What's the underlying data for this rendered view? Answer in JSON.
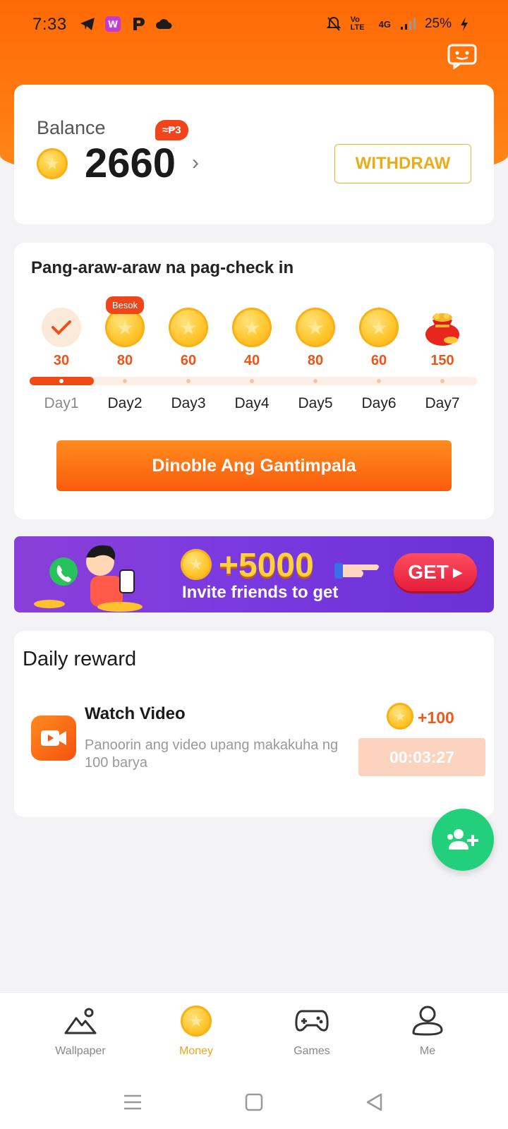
{
  "status_bar": {
    "time": "7:33",
    "network": "Vo LTE",
    "signal": "4G",
    "battery": "25%"
  },
  "balance": {
    "label": "Balance",
    "value": "2660",
    "peso_badge": "≈₱3",
    "withdraw_label": "WITHDRAW"
  },
  "checkin": {
    "title": "Pang-araw-araw na pag-check in",
    "tomorrow_badge": "Besok",
    "days": [
      {
        "amount": "30",
        "label": "Day1",
        "state": "checked"
      },
      {
        "amount": "80",
        "label": "Day2",
        "state": "coin"
      },
      {
        "amount": "60",
        "label": "Day3",
        "state": "coin"
      },
      {
        "amount": "40",
        "label": "Day4",
        "state": "coin"
      },
      {
        "amount": "80",
        "label": "Day5",
        "state": "coin"
      },
      {
        "amount": "60",
        "label": "Day6",
        "state": "coin"
      },
      {
        "amount": "150",
        "label": "Day7",
        "state": "bag"
      }
    ],
    "progress_fraction": 0.143,
    "double_button_label": "Dinoble Ang Gantimpala"
  },
  "banner": {
    "amount": "+5000",
    "text": "Invite friends to get",
    "get_label": "GET"
  },
  "daily_reward": {
    "title": "Daily reward",
    "task_name": "Watch Video",
    "task_desc": "Panoorin ang video upang makakuha ng 100 barya",
    "reward": "+100",
    "timer": "00:03:27"
  },
  "bottom_nav": {
    "items": [
      {
        "label": "Wallpaper",
        "icon": "wallpaper-icon",
        "active": false
      },
      {
        "label": "Money",
        "icon": "money-coin-icon",
        "active": true
      },
      {
        "label": "Games",
        "icon": "gamepad-icon",
        "active": false
      },
      {
        "label": "Me",
        "icon": "profile-icon",
        "active": false
      }
    ]
  },
  "colors": {
    "brand_orange": "#ff6a06",
    "accent_gold": "#e6a91c",
    "red_badge": "#f0441a",
    "fab_green": "#22cf7a"
  }
}
